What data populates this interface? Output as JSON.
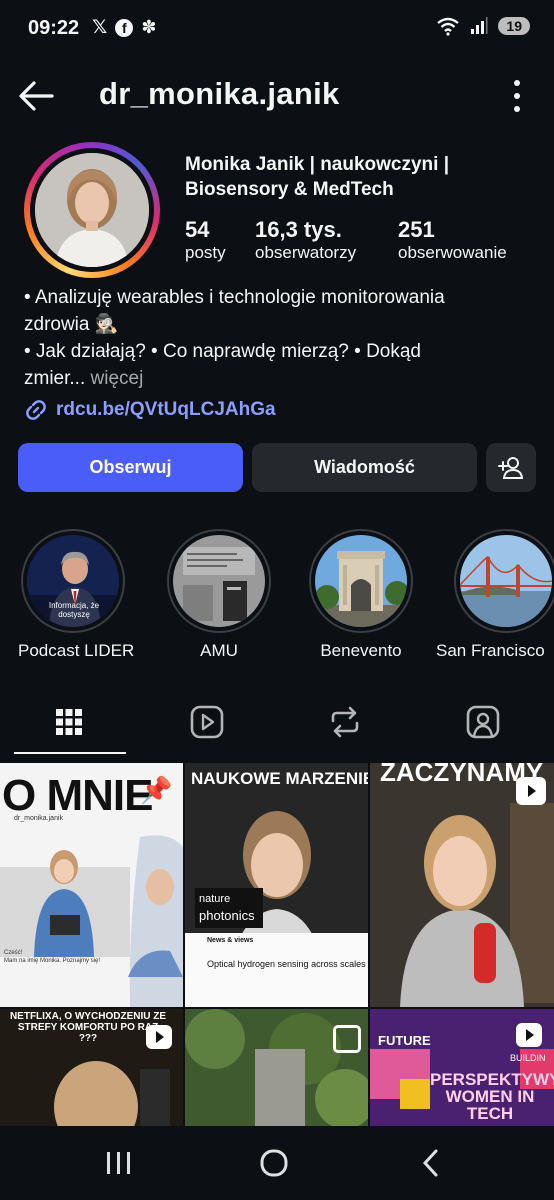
{
  "status_bar": {
    "time": "09:22",
    "battery": "19"
  },
  "header": {
    "username": "dr_monika.janik"
  },
  "profile": {
    "full_name_line1": "Monika Janik | naukowczyni |",
    "full_name_line2": "Biosensory & MedTech",
    "stats": [
      {
        "value": "54",
        "label": "posty"
      },
      {
        "value": "16,3 tys.",
        "label": "obserwatorzy"
      },
      {
        "value": "251",
        "label": "obserwowanie"
      }
    ],
    "bio_line1": "• Analizuję wearables i technologie monitorowania",
    "bio_line2": "zdrowia 🕵🏻",
    "bio_line3": "• Jak działają? • Co naprawdę mierzą? • Dokąd",
    "bio_line4_start": "zmier...",
    "bio_more": "więcej",
    "link": "rdcu.be/QVtUqLCJAhGa"
  },
  "buttons": {
    "follow": "Obserwuj",
    "message": "Wiadomość"
  },
  "highlights": [
    {
      "label": "Podcast LIDER",
      "overlay": "Informacja, że dostyszę"
    },
    {
      "label": "AMU"
    },
    {
      "label": "Benevento"
    },
    {
      "label": "San Francisco"
    }
  ],
  "posts": [
    {
      "title": "O MNIE",
      "handle": "dr_monika.janik",
      "caption": "Cześć!\nMam na imię Monika. Poznajmy się!"
    },
    {
      "title": "NAUKOWE MARZENIE",
      "journal1": "nature",
      "journal2": "photonics",
      "section": "News & views",
      "article": "Optical hydrogen sensing across scales"
    },
    {
      "title": "ZACZYNAMY"
    },
    {
      "title": "NETFLIXA, O WYCHODZENIU ZE STREFY KOMFORTU PO RAZ ???"
    },
    {
      "title": ""
    },
    {
      "title": "PERSPEKTYWY WOMEN IN TECH",
      "sub": "FUTURE",
      "tag": "BUILDIN"
    }
  ],
  "colors": {
    "accent": "#4a5df9",
    "link": "#8c9eff",
    "background": "#0c1014",
    "button": "#25292e"
  }
}
